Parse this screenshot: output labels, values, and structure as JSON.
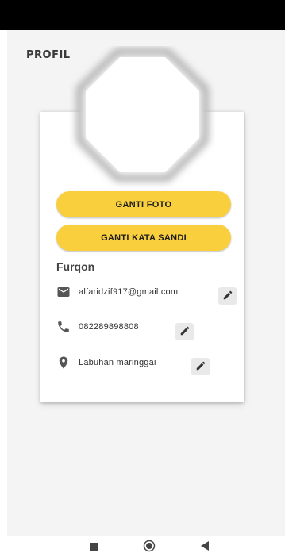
{
  "page_title": "PROFIL",
  "profile": {
    "name": "Furqon",
    "email": "alfaridzif917@gmail.com",
    "phone": "082289898808",
    "location": "Labuhan maringgai"
  },
  "buttons": {
    "change_photo": "GANTI FOTO",
    "change_password": "GANTI KATA SANDI"
  },
  "icons": {
    "email": "email-icon",
    "phone": "phone-icon",
    "location": "location-pin-icon",
    "edit": "pencil-icon",
    "nav_back": "back-triangle-icon",
    "nav_home": "home-circle-icon",
    "nav_recents": "recents-square-icon"
  },
  "colors": {
    "accent": "#f9cf3d",
    "background": "#f4f4f4",
    "card": "#ffffff",
    "status_bar": "#000000"
  }
}
